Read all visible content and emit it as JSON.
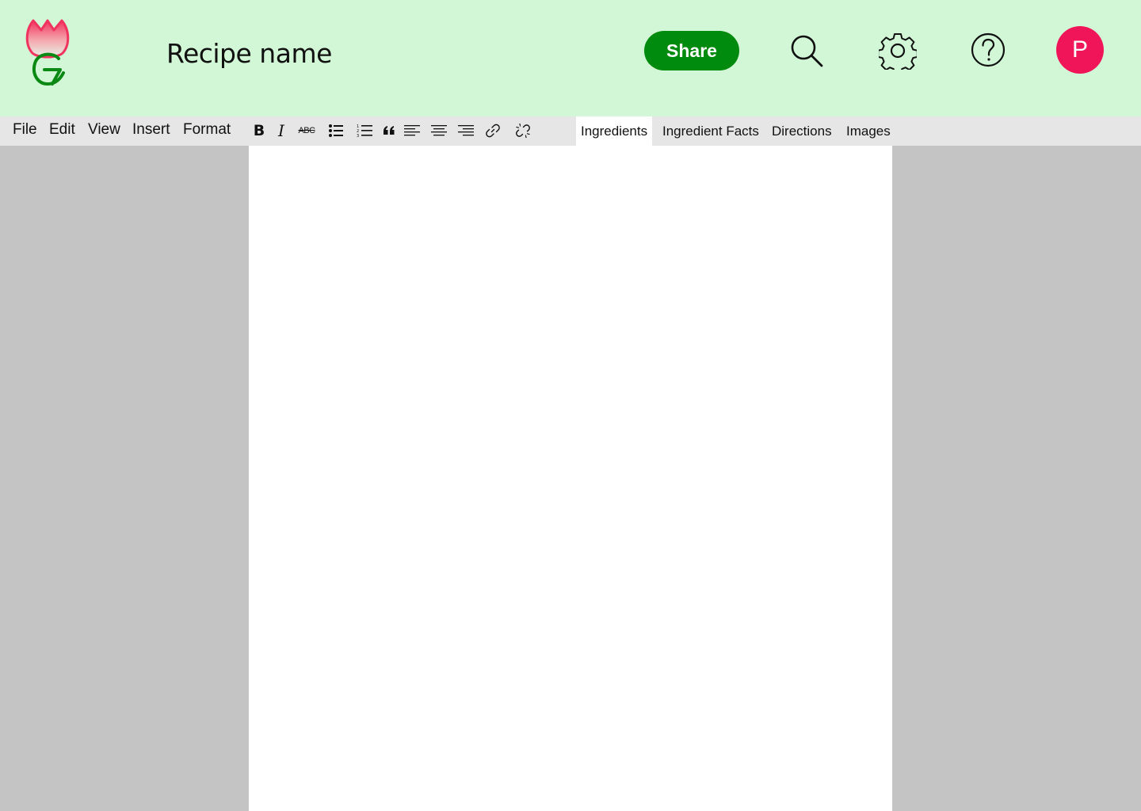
{
  "header": {
    "doc_title": "Recipe name",
    "share_label": "Share",
    "avatar_initial": "P",
    "colors": {
      "background": "#d2f7d6",
      "share_button": "#008a0e",
      "avatar": "#f01559",
      "logo_flame": "#f0345e",
      "logo_letter": "#0a8a14"
    },
    "icons": [
      "logo-icon",
      "search-icon",
      "gear-icon",
      "help-icon"
    ]
  },
  "menu": {
    "items": [
      "File",
      "Edit",
      "View",
      "Insert",
      "Format"
    ]
  },
  "format_toolbar": {
    "icons": [
      "bold-icon",
      "italic-icon",
      "strikethrough-icon",
      "bulleted-list-icon",
      "numbered-list-icon",
      "blockquote-icon",
      "align-left-icon",
      "align-center-icon",
      "align-right-icon",
      "link-icon",
      "unlink-icon"
    ],
    "bold_glyph": "B",
    "italic_glyph": "I",
    "strike_glyph": "ABC"
  },
  "tabs": {
    "items": [
      "Ingredients",
      "Ingredient Facts",
      "Directions",
      "Images"
    ],
    "active": "Ingredients"
  },
  "editor": {
    "content": ""
  }
}
